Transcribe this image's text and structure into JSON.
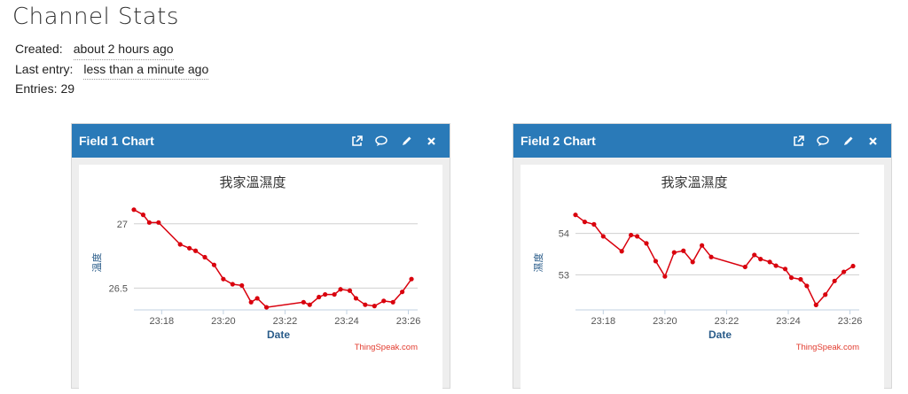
{
  "page": {
    "title": "Channel Stats",
    "created_label": "Created:",
    "created_value": "about 2 hours ago",
    "last_entry_label": "Last entry:",
    "last_entry_value": "less than a minute ago",
    "entries_label": "Entries:",
    "entries_value": "29"
  },
  "colors": {
    "header": "#2a7ab8",
    "series": "#d9000d",
    "axis_label": "#2a5c8a"
  },
  "cards": [
    {
      "title": "Field 1 Chart",
      "icons": [
        "external-link-icon",
        "comment-icon",
        "pencil-icon",
        "close-icon"
      ],
      "watermark": "ThingSpeak.com"
    },
    {
      "title": "Field 2 Chart",
      "icons": [
        "external-link-icon",
        "comment-icon",
        "pencil-icon",
        "close-icon"
      ],
      "watermark": "ThingSpeak.com"
    }
  ],
  "chart_data": [
    {
      "type": "line",
      "title": "我家溫濕度",
      "xlabel": "Date",
      "ylabel": "溫度",
      "x_ticks": [
        "23:18",
        "23:20",
        "23:22",
        "23:24",
        "23:26"
      ],
      "y_ticks": [
        27,
        26.5
      ],
      "ylim": [
        26.33,
        27.15
      ],
      "xlim_minutes": [
        17.1,
        26.3
      ],
      "grid": true,
      "series": [
        {
          "x": [
            "23:17.1",
            "23:17.4",
            "23:17.6",
            "23:17.9",
            "23:18.6",
            "23:18.9",
            "23:19.1",
            "23:19.4",
            "23:19.7",
            "23:20.0",
            "23:20.3",
            "23:20.6",
            "23:20.9",
            "23:21.1",
            "23:21.4",
            "23:22.6",
            "23:22.8",
            "23:23.1",
            "23:23.3",
            "23:23.6",
            "23:23.8",
            "23:24.1",
            "23:24.3",
            "23:24.6",
            "23:24.9",
            "23:25.2",
            "23:25.5",
            "23:25.8",
            "23:26.1"
          ],
          "values": [
            27.11,
            27.07,
            27.01,
            27.01,
            26.84,
            26.81,
            26.79,
            26.74,
            26.68,
            26.57,
            26.53,
            26.52,
            26.39,
            26.42,
            26.35,
            26.39,
            26.37,
            26.43,
            26.45,
            26.45,
            26.49,
            26.48,
            26.42,
            26.37,
            26.36,
            26.4,
            26.39,
            26.47,
            26.57
          ]
        }
      ]
    },
    {
      "type": "line",
      "title": "我家溫濕度",
      "xlabel": "Date",
      "ylabel": "濕度",
      "x_ticks": [
        "23:18",
        "23:20",
        "23:22",
        "23:24",
        "23:26"
      ],
      "y_ticks": [
        54,
        53
      ],
      "ylim": [
        52.15,
        54.7
      ],
      "xlim_minutes": [
        17.1,
        26.3
      ],
      "grid": true,
      "series": [
        {
          "x": [
            "23:17.1",
            "23:17.4",
            "23:17.7",
            "23:18.0",
            "23:18.6",
            "23:18.9",
            "23:19.1",
            "23:19.4",
            "23:19.7",
            "23:20.0",
            "23:20.3",
            "23:20.6",
            "23:20.9",
            "23:21.2",
            "23:21.5",
            "23:22.6",
            "23:22.9",
            "23:23.1",
            "23:23.4",
            "23:23.6",
            "23:23.9",
            "23:24.1",
            "23:24.4",
            "23:24.6",
            "23:24.9",
            "23:25.2",
            "23:25.5",
            "23:25.8",
            "23:26.1"
          ],
          "values": [
            54.45,
            54.28,
            54.22,
            53.93,
            53.57,
            53.96,
            53.93,
            53.76,
            53.33,
            52.96,
            53.54,
            53.58,
            53.31,
            53.71,
            53.43,
            53.19,
            53.48,
            53.38,
            53.31,
            53.22,
            53.14,
            52.93,
            52.89,
            52.73,
            52.27,
            52.52,
            52.85,
            53.07,
            53.21
          ]
        }
      ]
    }
  ]
}
